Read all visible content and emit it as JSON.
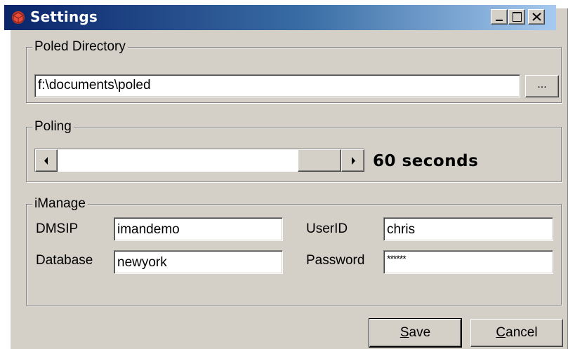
{
  "window": {
    "title": "Settings",
    "controls": [
      "minimize",
      "maximize",
      "close"
    ]
  },
  "directory_group": {
    "label": "Poled Directory",
    "path_value": "f:\\documents\\poled",
    "browse_label": "..."
  },
  "poling_group": {
    "label": "Poling",
    "slider_fraction": 0.84,
    "value_text": "60 seconds"
  },
  "imanage_group": {
    "label": "iManage",
    "dmsip_label": "DMSIP",
    "dmsip_value": "imandemo",
    "userid_label": "UserID",
    "userid_value": "chris",
    "database_label": "Database",
    "database_value": "newyork",
    "password_label": "Password",
    "password_value": "******"
  },
  "buttons": {
    "save_underlined": "S",
    "save_rest": "ave",
    "cancel_underlined": "C",
    "cancel_rest": "ancel"
  },
  "colors": {
    "face": "#d4d0c8",
    "title_start": "#0a246a",
    "title_end": "#a6caf0"
  }
}
